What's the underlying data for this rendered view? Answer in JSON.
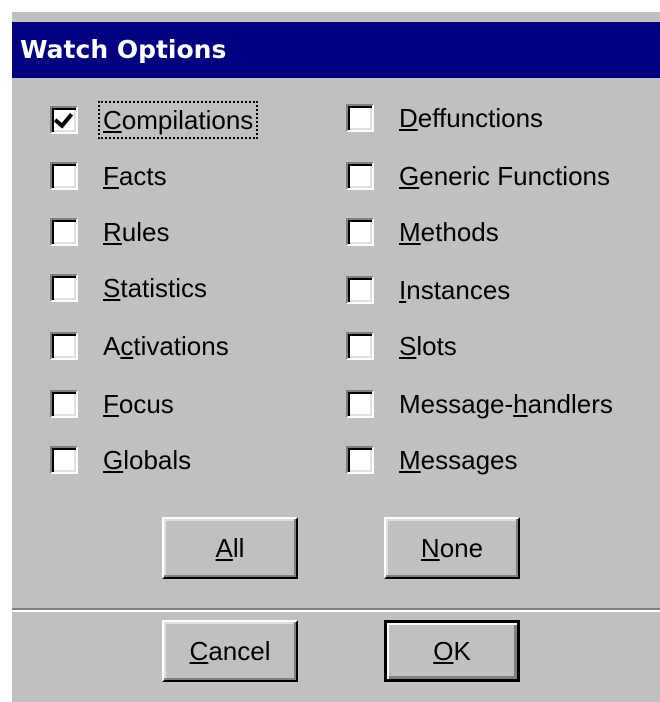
{
  "dialog": {
    "title": "Watch Options"
  },
  "left_options": [
    {
      "pre": "",
      "key": "C",
      "post": "ompilations",
      "checked": true
    },
    {
      "pre": "",
      "key": "F",
      "post": "acts",
      "checked": false
    },
    {
      "pre": "",
      "key": "R",
      "post": "ules",
      "checked": false
    },
    {
      "pre": "",
      "key": "S",
      "post": "tatistics",
      "checked": false
    },
    {
      "pre": "A",
      "key": "c",
      "post": "tivations",
      "checked": false
    },
    {
      "pre": "",
      "key": "F",
      "post": "ocus",
      "checked": false
    },
    {
      "pre": "",
      "key": "G",
      "post": "lobals",
      "checked": false
    }
  ],
  "right_options": [
    {
      "pre": "",
      "key": "D",
      "post": "effunctions",
      "checked": false
    },
    {
      "pre": "",
      "key": "G",
      "post": "eneric Functions",
      "checked": false
    },
    {
      "pre": "",
      "key": "M",
      "post": "ethods",
      "checked": false
    },
    {
      "pre": "",
      "key": "I",
      "post": "nstances",
      "checked": false
    },
    {
      "pre": "",
      "key": "S",
      "post": "lots",
      "checked": false
    },
    {
      "pre": "Message-",
      "key": "h",
      "post": "andlers",
      "checked": false
    },
    {
      "pre": "",
      "key": "M",
      "post": "essages",
      "checked": false
    }
  ],
  "buttons": {
    "all": {
      "pre": "",
      "key": "A",
      "post": "ll"
    },
    "none": {
      "pre": "",
      "key": "N",
      "post": "one"
    },
    "cancel": {
      "pre": "",
      "key": "C",
      "post": "ancel"
    },
    "ok": {
      "pre": "",
      "key": "O",
      "post": "K"
    }
  },
  "icons": {
    "checkmark": "check-icon"
  }
}
